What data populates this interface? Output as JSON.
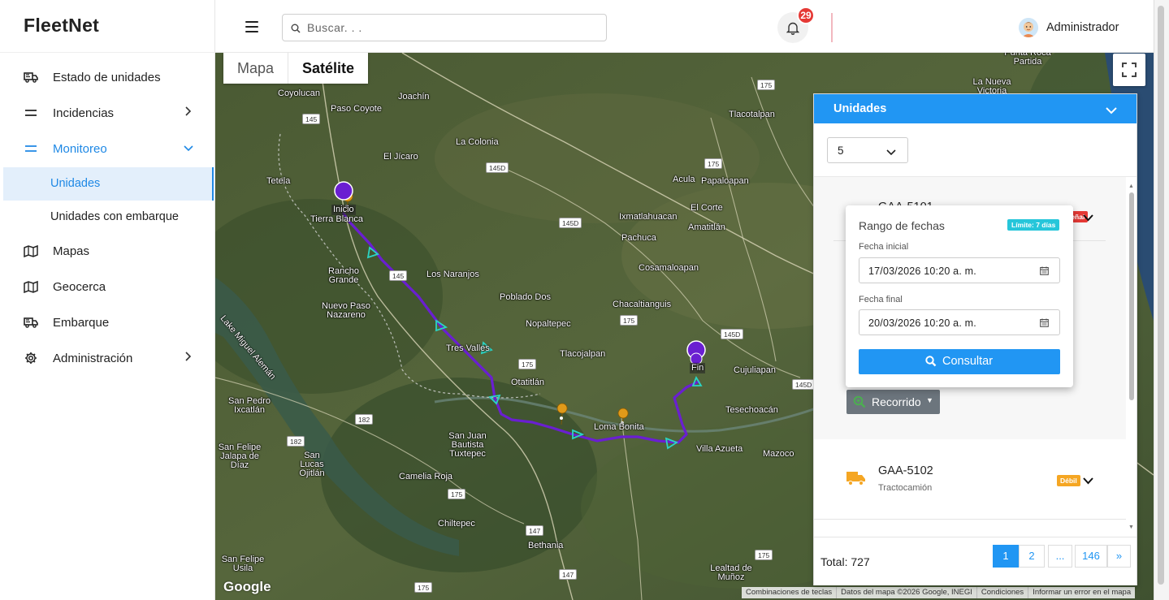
{
  "app": {
    "logo": "FleetNet"
  },
  "sidebar": {
    "items": [
      {
        "label": "Estado de unidades",
        "icon": "truck-icon"
      },
      {
        "label": "Incidencias",
        "icon": "lines-icon",
        "chevron": "›"
      },
      {
        "label": "Monitoreo",
        "icon": "lines-icon",
        "chevron": "⌄",
        "active": true
      },
      {
        "label": "Mapas",
        "icon": "map-icon"
      },
      {
        "label": "Geocerca",
        "icon": "map-icon"
      },
      {
        "label": "Embarque",
        "icon": "truck-icon"
      },
      {
        "label": "Administración",
        "icon": "gear-icon",
        "chevron": "›"
      }
    ],
    "subitems": [
      {
        "label": "Unidades",
        "selected": true
      },
      {
        "label": "Unidades con embarque"
      }
    ]
  },
  "header": {
    "search_placeholder": "Buscar. . .",
    "notifications": "29",
    "user": "Administrador"
  },
  "map": {
    "type_map": "Mapa",
    "type_satellite": "Satélite",
    "google": "Google",
    "attribution": [
      "Combinaciones de teclas",
      "Datos del mapa ©2026 Google, INEGI",
      "Condiciones",
      "Informar un error en el mapa"
    ],
    "start_label": "Inicio",
    "end_label": "Fin",
    "places": [
      "Coyolucan",
      "Paso Coyote",
      "Joachín",
      "La Colonia",
      "El Jícaro",
      "Tetela",
      "Tierra Blanca",
      "Rancho Grande",
      "Los Naranjos",
      "Nuevo Paso Nazareno",
      "Poblado Dos",
      "Nopaltepec",
      "Tres Valles",
      "Tlacojalpan",
      "Otatitlán",
      "Lake Miguel Alemán",
      "San Pedro Ixcatlán",
      "San Juan Bautista Tuxtepec",
      "San Felipe Jalapa de Díaz",
      "San Lucas Ojitlán",
      "Camelia Roja",
      "Chiltepec",
      "Bethania",
      "San Felipe Usila",
      "Loma Bonita",
      "Villa Azueta",
      "Tesechoacán",
      "Mazoco",
      "Cujuliapan",
      "Chacaltianguis",
      "Cosamaloapan",
      "Pachuca",
      "Ixmatlahuacan",
      "El Corte",
      "Amatitlán",
      "Acula",
      "Papaloapan",
      "Tlacotalpan",
      "La Nueva Victoria",
      "Punta Roca Partida",
      "Lealtad de Muñoz"
    ]
  },
  "panel": {
    "title": "Unidades",
    "page_size": "5",
    "units": [
      {
        "name": "GAA-5101",
        "status": "Sin señal",
        "status_color": "#e53935"
      },
      {
        "name": "GAA-5102",
        "type": "Tractocamión",
        "status": "Débil",
        "status_color": "#f5a623"
      }
    ],
    "route_button": "Recorrido",
    "total": "Total: 727",
    "pages": [
      "1",
      "2",
      "...",
      "146",
      "»"
    ]
  },
  "popup": {
    "title": "Rango de fechas",
    "limit": "Límite: 7 días",
    "start_label": "Fecha inicial",
    "start_value": "17/03/2026 10:20  a. m.",
    "end_label": "Fecha final",
    "end_value": "20/03/2026 10:20  a. m.",
    "submit": "Consultar"
  },
  "colors": {
    "accent": "#2196f3",
    "route": "#6a1fd1",
    "danger": "#e53935",
    "warning": "#f5a623"
  }
}
